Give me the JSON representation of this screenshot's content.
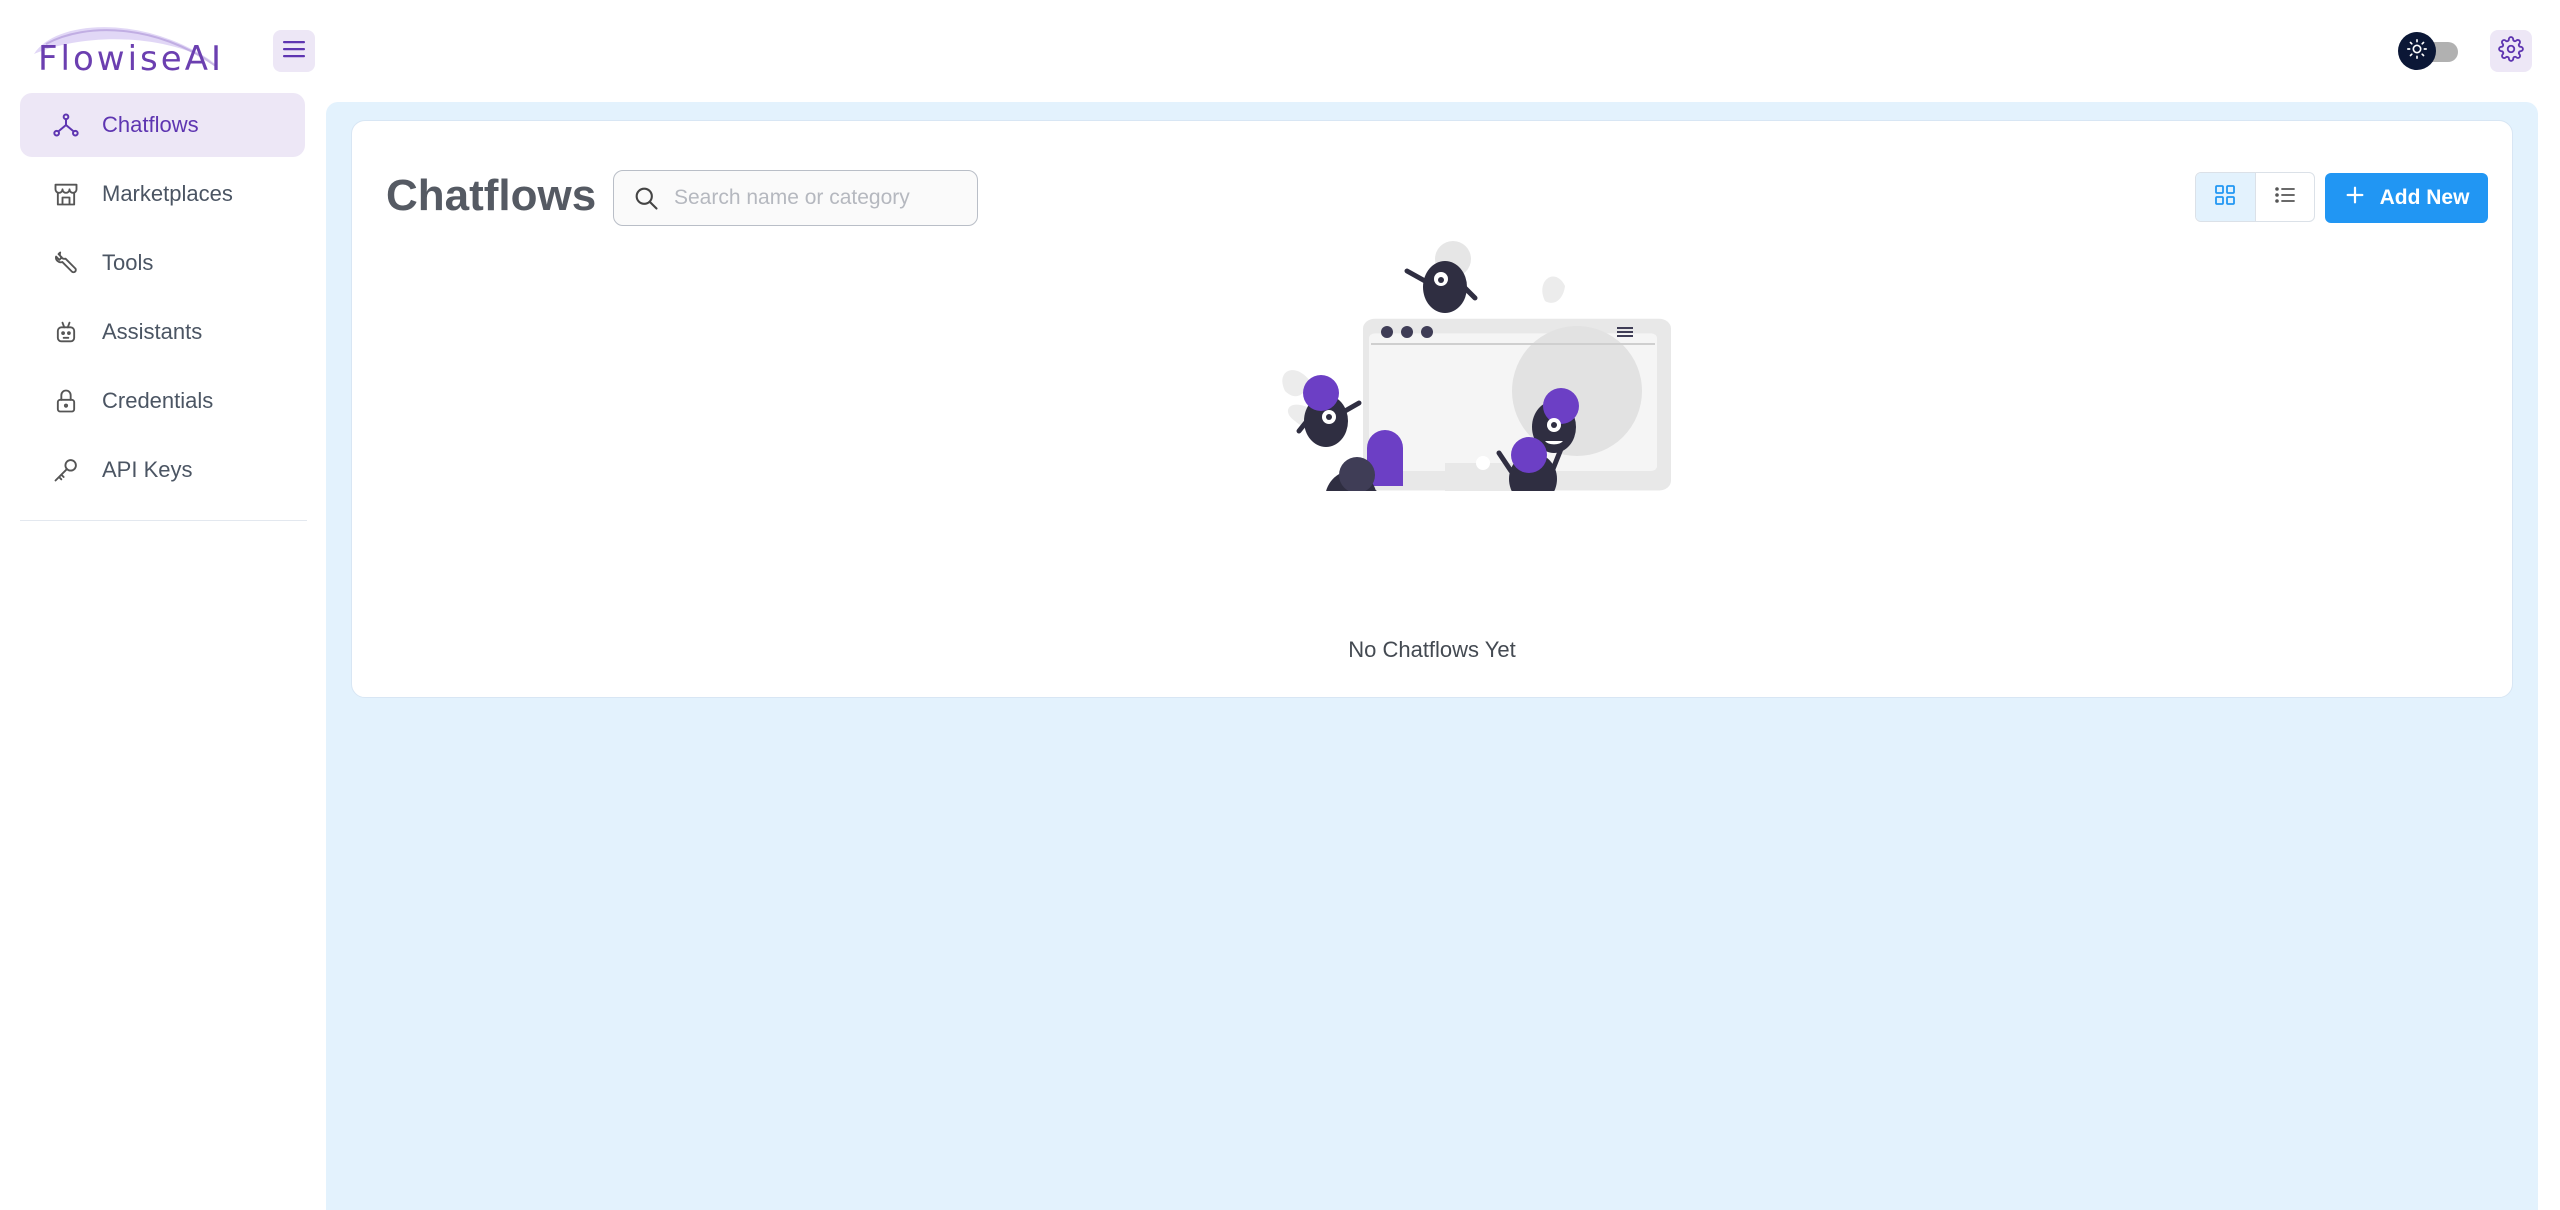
{
  "header": {
    "logo_text": "FlowiseAI",
    "menu_icon": "hamburger-icon",
    "theme_toggle_icon": "sun-icon",
    "settings_icon": "gear-icon",
    "accent_color": "#ede7f6",
    "brand_color": "#673ab7"
  },
  "sidebar": {
    "items": [
      {
        "label": "Chatflows",
        "icon": "chatflows-icon",
        "active": true
      },
      {
        "label": "Marketplaces",
        "icon": "store-icon",
        "active": false
      },
      {
        "label": "Tools",
        "icon": "wrench-icon",
        "active": false
      },
      {
        "label": "Assistants",
        "icon": "robot-icon",
        "active": false
      },
      {
        "label": "Credentials",
        "icon": "lock-icon",
        "active": false
      },
      {
        "label": "API Keys",
        "icon": "key-icon",
        "active": false
      }
    ]
  },
  "main": {
    "title": "Chatflows",
    "search": {
      "placeholder": "Search name or category",
      "value": ""
    },
    "view_modes": [
      {
        "icon": "grid-icon",
        "active": true
      },
      {
        "icon": "list-icon",
        "active": false
      }
    ],
    "add_button_label": "Add New",
    "add_button_color": "#2196f3",
    "empty_text": "No Chatflows Yet"
  }
}
